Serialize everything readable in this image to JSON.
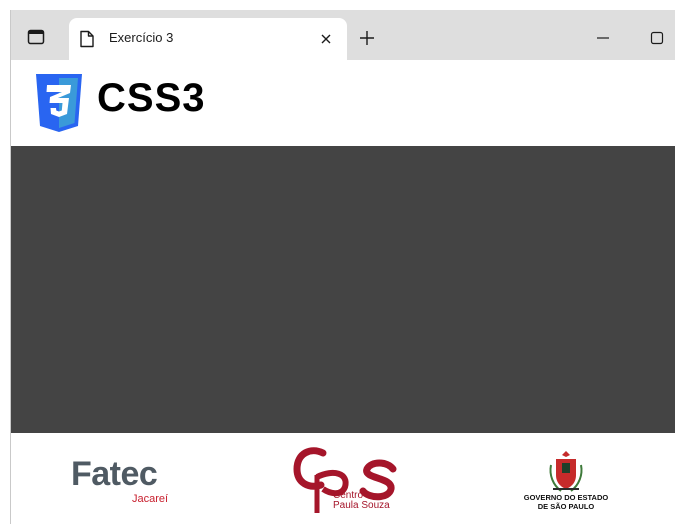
{
  "browser": {
    "tab": {
      "title": "Exercício 3"
    },
    "icons": {
      "tab_actions": "tab-actions-icon",
      "page": "page-icon",
      "close": "close-icon",
      "new_tab": "plus-icon",
      "minimize": "minimize-icon",
      "maximize": "maximize-icon"
    }
  },
  "page": {
    "header": {
      "title": "CSS3",
      "logo_icon": "css3-shield-icon"
    },
    "content": {
      "background": "#444444"
    },
    "footer": {
      "fatec": {
        "name": "Fatec",
        "subtitle": "Jacareí"
      },
      "cps": {
        "line1": "Centro",
        "line2": "Paula Souza"
      },
      "gov": {
        "line1": "GOVERNO DO ESTADO",
        "line2": "DE SÃO PAULO"
      }
    }
  },
  "colors": {
    "tabbar": "#dedede",
    "css3_blue": "#2965f1",
    "css3_blue_light": "#3a9ad9",
    "fatec_gray": "#4f5a63",
    "fatec_red": "#c8202f",
    "cps_red": "#a5152a",
    "gov_red": "#c62b2b"
  }
}
